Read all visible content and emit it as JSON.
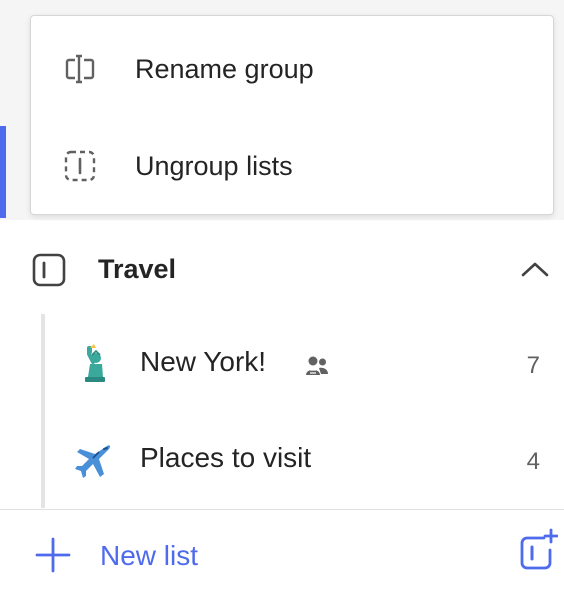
{
  "colors": {
    "accent": "#4f6bed",
    "text": "#242424",
    "muted": "#616161"
  },
  "context_menu": {
    "items": [
      {
        "label": "Rename group",
        "icon": "rename-group-icon"
      },
      {
        "label": "Ungroup lists",
        "icon": "ungroup-lists-icon"
      }
    ]
  },
  "group": {
    "label": "Travel",
    "icon": "group-icon",
    "expanded": true,
    "lists": [
      {
        "label": "New York!",
        "emoji": "statue-of-liberty",
        "count": "7",
        "shared": true
      },
      {
        "label": "Places to visit",
        "emoji": "airplane",
        "count": "4",
        "shared": false
      }
    ]
  },
  "footer": {
    "new_list_label": "New list",
    "new_group_icon": "add-group-icon"
  }
}
